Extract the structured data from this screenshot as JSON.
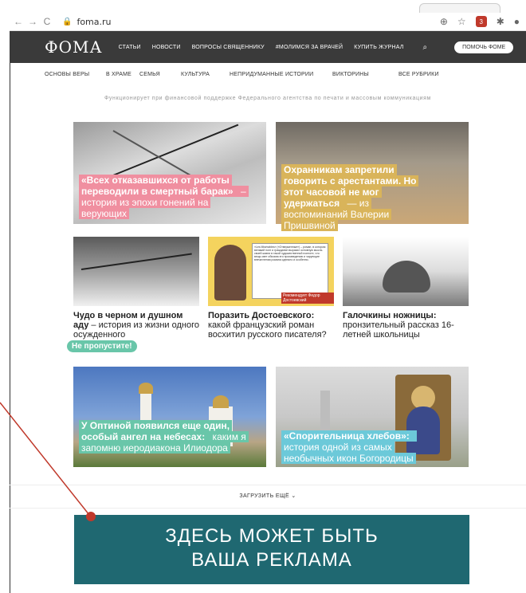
{
  "browser": {
    "url": "foma.ru",
    "ext_count": "3"
  },
  "site": {
    "logo": "ФОМА",
    "menu": [
      "СТАТЬИ",
      "НОВОСТИ",
      "ВОПРОСЫ СВЯЩЕННИКУ",
      "#МОЛИМСЯ ЗА ВРАЧЕЙ",
      "КУПИТЬ ЖУРНАЛ"
    ],
    "help_button": "ПОМОЧЬ ФОМЕ",
    "subnav": [
      "ОСНОВЫ ВЕРЫ",
      "В ХРАМЕ",
      "СЕМЬЯ",
      "КУЛЬТУРА",
      "НЕПРИДУМАННЫЕ ИСТОРИИ",
      "ВИКТОРИНЫ",
      "ВСЕ РУБРИКИ"
    ],
    "tagline": "Функционирует при финансовой поддержке Федерального агентства по печати и массовым коммуникациям"
  },
  "cards": {
    "c1": {
      "bold": "«Всех отказавшихся от работы переводили в смертный барак»",
      "rest": " – история из эпохи гонений на верующих"
    },
    "c2": {
      "bold": "Охранникам запретили говорить с арестантами. Но этот часовой не мог удержаться",
      "rest": " — из воспоминаний Валерии Пришвиной"
    },
    "c3": {
      "bold": "Чудо в черном и душном аду",
      "rest": " – история из жизни одного осужденного"
    },
    "c4": {
      "bold": "Поразить Достоевского:",
      "rest": " какой французский роман восхитил русского писателя?"
    },
    "c4_book_text": "«Les Misérables» («Отверженные») – роман, в котором великий поэт и гражданин выразил основную мысль своей жизни в такой художественной полноте, что вещь свет обязана его произведению и чарующие впечатления романа сделало и особенно.",
    "c4_book_sign": "Рекомендует Федор Достоевский",
    "c5": {
      "bold": "Галочкины ножницы:",
      "rest": " пронзительный рассказ 16-летней школьницы"
    },
    "c6": {
      "bold": "У Оптиной появился еще один, особый ангел на небесах:",
      "rest": " каким я запомню иеродиакона Илиодора"
    },
    "c7": {
      "bold": "«Спорительница хлебов»:",
      "rest": " история одной из самых необычных икон Богородицы"
    }
  },
  "badge": "Не пропустите!",
  "load_more": "ЗАГРУЗИТЬ ЕЩЁ",
  "ad": {
    "line1": "ЗДЕСЬ МОЖЕТ БЫТЬ",
    "line2": "ВАША РЕКЛАМА"
  },
  "colors": {
    "header_bg": "#3a3a3a",
    "pink": "#f08fa0",
    "gold": "#d9b45a",
    "cyan": "#6cc9d9",
    "ad_bg": "#1f6871",
    "annotation": "#c0392b"
  }
}
